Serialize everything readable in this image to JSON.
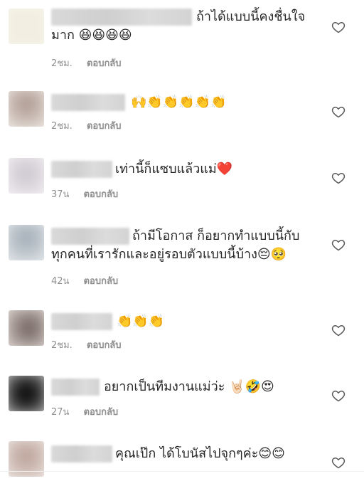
{
  "comments": [
    {
      "text1": "ถ้าได้แบบนี้คงชื่นใจ",
      "text2": "มาก 😆😆😆😆",
      "time": "2ชม.",
      "reply": "ตอบกลับ",
      "icon": "heart-outline-icon"
    },
    {
      "text1": "🙌👏👏👏👏👏",
      "text2": "",
      "time": "2ชม.",
      "reply": "ตอบกลับ",
      "icon": "heart-outline-icon"
    },
    {
      "text1": "เท่านี้ก็แซบแล้วแม่❤️",
      "text2": "",
      "time": "37น",
      "reply": "ตอบกลับ",
      "icon": "heart-outline-icon"
    },
    {
      "text1": "ถ้ามีโอกาส ก็อยากทำแบบนี้กับ",
      "text2": "ทุกคนที่เรารักและอยู่รอบตัวแบบนี้บ้าง😔🥺",
      "time": "42น",
      "reply": "ตอบกลับ",
      "icon": "heart-outline-icon"
    },
    {
      "text1": "👏👏👏",
      "text2": "",
      "time": "2ชม.",
      "reply": "ตอบกลับ",
      "icon": "heart-outline-icon"
    },
    {
      "text1": "อยากเป็นทีมงานแม่ว่ะ 🤘🏻🤣😍",
      "text2": "",
      "time": "27น",
      "reply": "ตอบกลับ",
      "icon": "heart-outline-icon"
    },
    {
      "text1": "คุณเป๊ก  ได้โบนัสไปจุกๆค่ะ😊😊",
      "text2": "",
      "time": "",
      "reply": "",
      "icon": "heart-outline-icon"
    }
  ]
}
